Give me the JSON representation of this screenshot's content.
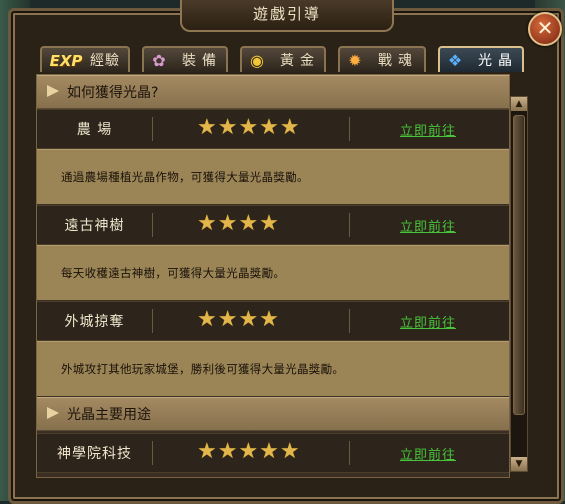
{
  "window": {
    "title": "遊戲引導",
    "close_symbol": "✕"
  },
  "tabs": [
    {
      "icon_text": "EXP",
      "icon": "exp-icon",
      "label": "經驗",
      "active": false
    },
    {
      "icon_text": "✿",
      "icon": "equipment-icon",
      "label": "裝備",
      "active": false
    },
    {
      "icon_text": "◉",
      "icon": "gold-coin-icon",
      "label": "黃金",
      "active": false
    },
    {
      "icon_text": "✹",
      "icon": "war-soul-icon",
      "label": "戰魂",
      "active": false
    },
    {
      "icon_text": "❖",
      "icon": "crystal-icon",
      "label": "光晶",
      "active": true
    }
  ],
  "sections": [
    {
      "title": "如何獲得光晶?",
      "items": [
        {
          "name": "農 場",
          "stars": 5,
          "stars_text": "★★★★★",
          "action": "立即前往",
          "description": "通過農場種植光晶作物，可獲得大量光晶獎勵。"
        },
        {
          "name": "遠古神樹",
          "stars": 4,
          "stars_text": "★★★★",
          "action": "立即前往",
          "description": "每天收穫遠古神樹，可獲得大量光晶獎勵。"
        },
        {
          "name": "外城掠奪",
          "stars": 4,
          "stars_text": "★★★★",
          "action": "立即前往",
          "description": "外城攻打其他玩家城堡，勝利後可獲得大量光晶獎勵。"
        }
      ]
    },
    {
      "title": "光晶主要用途",
      "items": [
        {
          "name": "神學院科技",
          "stars": 5,
          "stars_text": "★★★★★",
          "action": "立即前往"
        }
      ]
    }
  ],
  "scrollbar": {
    "up_symbol": "▲",
    "down_symbol": "▼"
  },
  "colors": {
    "link": "#47c43a",
    "star": "#e3b64b",
    "header_bg": "#a48a62",
    "desc_bg": "#9b8557"
  }
}
